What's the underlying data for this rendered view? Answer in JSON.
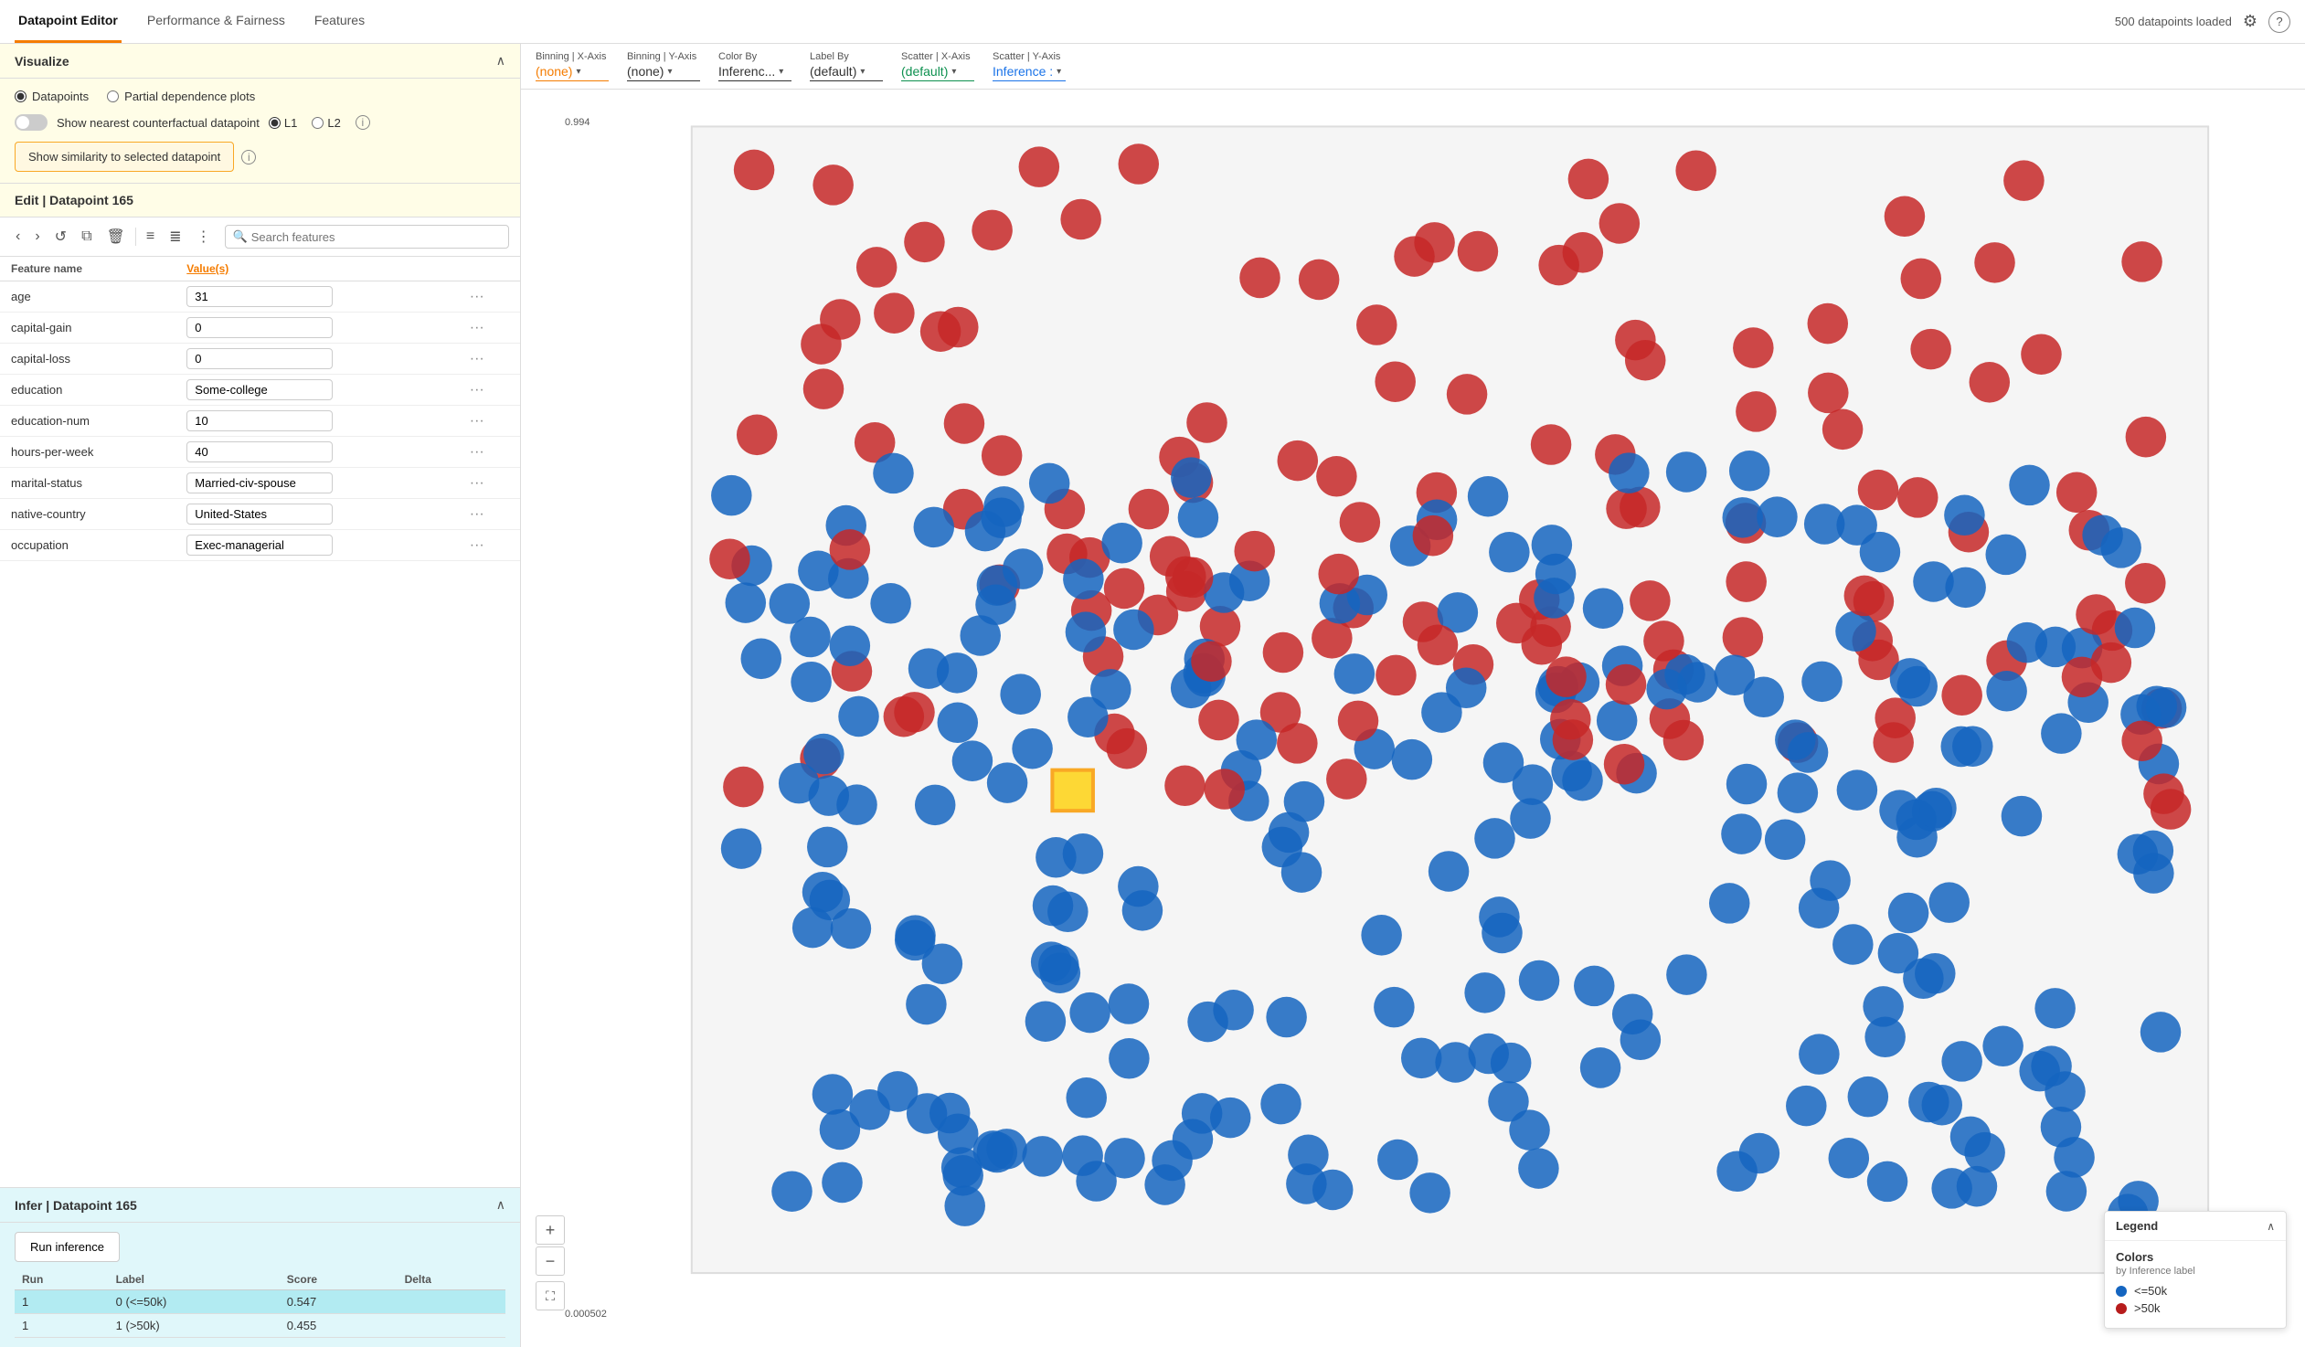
{
  "nav": {
    "tabs": [
      {
        "label": "Datapoint Editor",
        "active": true
      },
      {
        "label": "Performance & Fairness",
        "active": false
      },
      {
        "label": "Features",
        "active": false
      }
    ],
    "status": "500 datapoints loaded"
  },
  "visualize": {
    "title": "Visualize",
    "radio_options": [
      {
        "label": "Datapoints",
        "checked": true
      },
      {
        "label": "Partial dependence plots",
        "checked": false
      }
    ],
    "toggle_label": "Show nearest counterfactual datapoint",
    "norm_options": [
      {
        "label": "L1",
        "checked": true
      },
      {
        "label": "L2",
        "checked": false
      }
    ],
    "similarity_btn": "Show similarity to selected datapoint"
  },
  "edit": {
    "title": "Edit | Datapoint 165",
    "search_placeholder": "Search features",
    "col_feature": "Feature name",
    "col_value": "Value(s)",
    "features": [
      {
        "name": "age",
        "value": "31"
      },
      {
        "name": "capital-gain",
        "value": "0"
      },
      {
        "name": "capital-loss",
        "value": "0"
      },
      {
        "name": "education",
        "value": "Some-college"
      },
      {
        "name": "education-num",
        "value": "10"
      },
      {
        "name": "hours-per-week",
        "value": "40"
      },
      {
        "name": "marital-status",
        "value": "Married-civ-spouse"
      },
      {
        "name": "native-country",
        "value": "United-States"
      },
      {
        "name": "occupation",
        "value": "Exec-managerial"
      }
    ]
  },
  "infer": {
    "title": "Infer | Datapoint 165",
    "run_btn": "Run inference",
    "col_run": "Run",
    "col_label": "Label",
    "col_score": "Score",
    "col_delta": "Delta",
    "results": [
      {
        "run": "1",
        "label": "0 (<=50k)",
        "score": "0.547",
        "delta": "",
        "active": true
      },
      {
        "run": "1",
        "label": "1 (>50k)",
        "score": "0.455",
        "delta": "",
        "active": false
      }
    ]
  },
  "controls": {
    "binning_x": {
      "label": "Binning | X-Axis",
      "value": "(none)",
      "color": "orange"
    },
    "binning_y": {
      "label": "Binning | Y-Axis",
      "value": "(none)",
      "color": "default"
    },
    "color_by": {
      "label": "Color By",
      "value": "Inferenc...",
      "color": "default"
    },
    "label_by": {
      "label": "Label By",
      "value": "(default)",
      "color": "default"
    },
    "scatter_x": {
      "label": "Scatter | X-Axis",
      "value": "(default)",
      "color": "green"
    },
    "scatter_y": {
      "label": "Scatter | Y-Axis",
      "value": "Inference :",
      "color": "blue"
    }
  },
  "legend": {
    "title": "Legend",
    "colors_title": "Colors",
    "colors_subtitle": "by Inference label",
    "items": [
      {
        "label": "<=50k",
        "color": "blue"
      },
      {
        "label": ">50k",
        "color": "red"
      }
    ]
  },
  "yaxis": {
    "top": "0.994",
    "bottom": "0.000502"
  },
  "icons": {
    "settings": "⚙",
    "help": "?",
    "back": "‹",
    "forward": "›",
    "history": "↺",
    "copy": "⧉",
    "delete": "🗑",
    "list1": "≡",
    "list2": "≣",
    "list3": "⋮",
    "search": "🔍",
    "collapse": "∧",
    "zoom_in": "+",
    "zoom_out": "−",
    "fullscreen": "⛶",
    "chevron": "▾"
  }
}
